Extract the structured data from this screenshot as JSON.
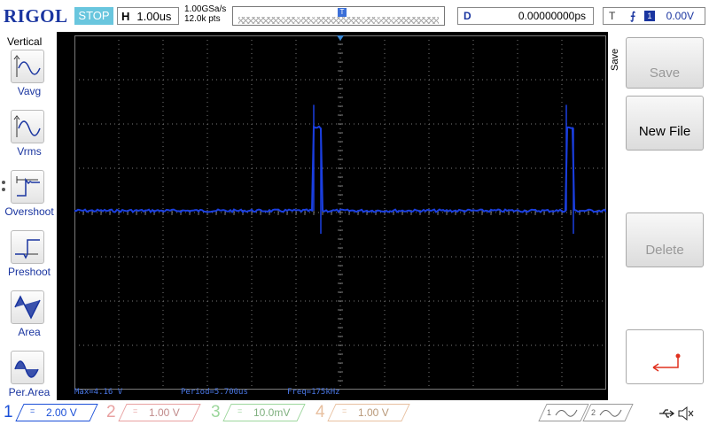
{
  "brand": "RIGOL",
  "run_state": "STOP",
  "timebase": {
    "label": "H",
    "value": "1.00us"
  },
  "sample": {
    "rate": "1.00GSa/s",
    "points": "12.0k pts"
  },
  "delay": {
    "label": "D",
    "value": "0.00000000ps"
  },
  "trigger": {
    "label": "T",
    "edge_icon": "rising-edge-icon",
    "source": "1",
    "level": "0.00V"
  },
  "left_menu": {
    "title": "Vertical",
    "items": [
      {
        "label": "Vavg",
        "icon": "vavg-icon"
      },
      {
        "label": "Vrms",
        "icon": "vrms-icon"
      },
      {
        "label": "Overshoot",
        "icon": "overshoot-icon"
      },
      {
        "label": "Preshoot",
        "icon": "preshoot-icon"
      },
      {
        "label": "Area",
        "icon": "area-icon"
      },
      {
        "label": "Per.Area",
        "icon": "per-area-icon"
      }
    ]
  },
  "right_menu": {
    "title": "Save",
    "buttons": [
      {
        "label": "Save",
        "enabled": false
      },
      {
        "label": "New File",
        "enabled": true
      },
      {
        "label": "Delete",
        "enabled": false
      },
      {
        "label": "",
        "icon": "return-icon",
        "enabled": true
      }
    ]
  },
  "measurements": {
    "max": "Max=4.16 V",
    "period": "Period=5.700us",
    "freq": "Freq=175kHz"
  },
  "channels": [
    {
      "num": "1",
      "coupling": "=",
      "scale": "2.00 V",
      "color": "#1a4fd8",
      "active": true
    },
    {
      "num": "2",
      "coupling": "=",
      "scale": "1.00 V",
      "color": "#e8a0a0",
      "active": false
    },
    {
      "num": "3",
      "coupling": "=",
      "scale": "10.0mV",
      "color": "#9cd69c",
      "active": false
    },
    {
      "num": "4",
      "coupling": "=",
      "scale": "1.00 V",
      "color": "#e8c0a0",
      "active": false
    }
  ],
  "math_buttons": [
    "1",
    "2"
  ],
  "status_icons": [
    "usb-icon",
    "speaker-muted-icon"
  ],
  "colors": {
    "trace": "#1a3fe0",
    "grid": "#7a7a7a",
    "accent": "#1a35a0",
    "stop": "#69c6de"
  },
  "signal": {
    "type": "pulse-train",
    "high_v": 4.16,
    "period_us": 5.7,
    "pulse_width_us": 0.1,
    "time_per_div_us": 1.0,
    "volts_per_div": 2.0,
    "baseline_v": 0
  }
}
